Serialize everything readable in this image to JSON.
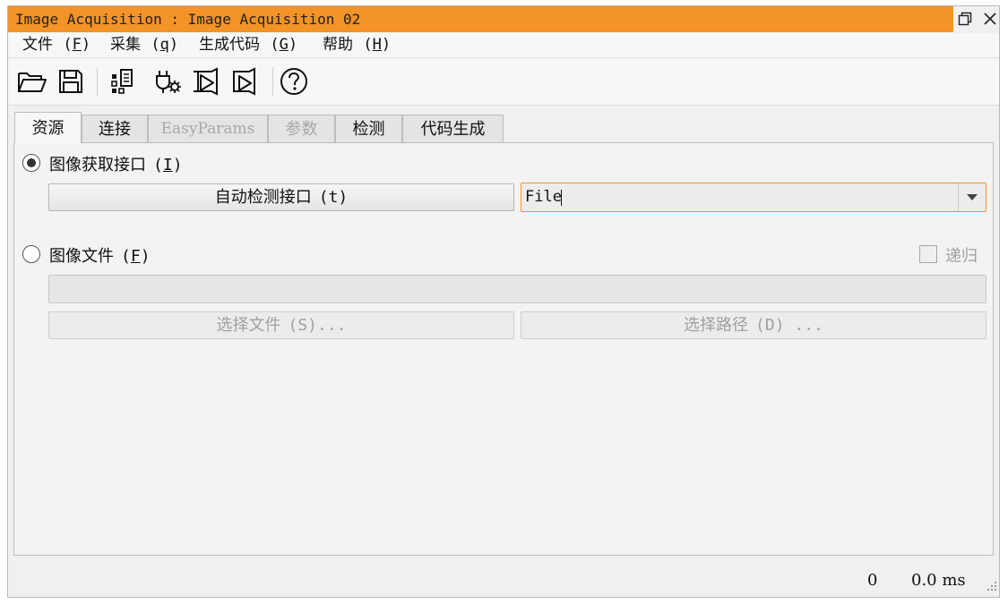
{
  "window": {
    "title": "Image Acquisition : Image Acquisition 02",
    "accent_color": "#f39328",
    "controls": [
      "restore-icon",
      "close-icon"
    ]
  },
  "menu": [
    {
      "label": "文件",
      "mnemonic": "F"
    },
    {
      "label": "采集",
      "mnemonic": "q"
    },
    {
      "label": "生成代码",
      "mnemonic": "G"
    },
    {
      "label": "帮助",
      "mnemonic": "H"
    }
  ],
  "toolbar": {
    "buttons": [
      "open-folder-icon",
      "save-icon",
      "connection-list-icon",
      "plugin-settings-icon",
      "play-snapshot-icon",
      "record-snapshot-icon",
      "help-icon"
    ]
  },
  "tabs": [
    {
      "label": "资源",
      "state": "active"
    },
    {
      "label": "连接",
      "state": "enabled"
    },
    {
      "label": "EasyParams",
      "state": "disabled"
    },
    {
      "label": "参数",
      "state": "disabled"
    },
    {
      "label": "检测",
      "state": "enabled"
    },
    {
      "label": "代码生成",
      "state": "enabled"
    }
  ],
  "source": {
    "interface": {
      "label": "图像获取接口",
      "mnemonic": "I",
      "selected": true,
      "autodetect_label": "自动检测接口",
      "autodetect_mnemonic": "t",
      "combo_value": "File"
    },
    "file": {
      "label": "图像文件",
      "mnemonic": "F",
      "selected": false,
      "recursive_label": "递归",
      "recursive_checked": false,
      "path_value": "",
      "select_file_label": "选择文件",
      "select_file_mnemonic": "S",
      "select_file_suffix": "...",
      "select_path_label": "选择路径",
      "select_path_mnemonic": "D",
      "select_path_suffix": " ..."
    }
  },
  "status": {
    "count": "0",
    "time": "0.0 ms"
  }
}
